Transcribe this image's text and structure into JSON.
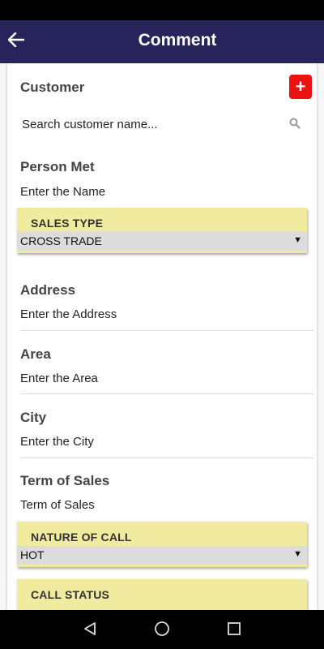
{
  "header": {
    "title": "Comment",
    "back_icon": "arrow-left-icon"
  },
  "customer": {
    "label": "Customer",
    "search_placeholder": "Search customer name...",
    "add_icon": "plus-icon",
    "search_icon": "search-icon"
  },
  "person_met": {
    "label": "Person Met",
    "placeholder": "Enter the Name"
  },
  "sales_type": {
    "label": "SALES TYPE",
    "selected": "CROSS TRADE"
  },
  "address": {
    "label": "Address",
    "placeholder": "Enter the Address"
  },
  "area": {
    "label": "Area",
    "placeholder": "Enter the Area"
  },
  "city": {
    "label": "City",
    "placeholder": "Enter the City"
  },
  "term_of_sales": {
    "label": "Term of Sales",
    "placeholder": "Term of Sales"
  },
  "nature_of_call": {
    "label": "NATURE OF CALL",
    "selected": "HOT"
  },
  "call_status": {
    "label": "CALL STATUS"
  },
  "nav": {
    "back_icon": "triangle-back-icon",
    "home_icon": "circle-home-icon",
    "recents_icon": "square-recents-icon"
  },
  "colors": {
    "app_bar": "#26245a",
    "accent_red": "#ee1111",
    "select_bg": "#f1eb9f"
  }
}
